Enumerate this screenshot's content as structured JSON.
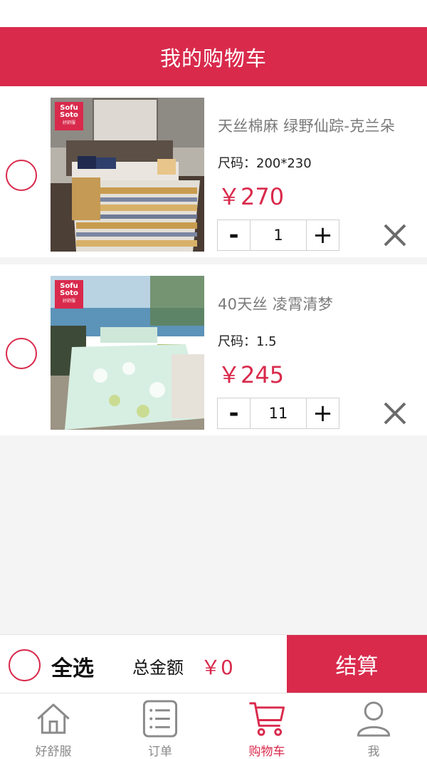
{
  "header": {
    "title": "我的购物车"
  },
  "cart": {
    "items": [
      {
        "title": "天丝棉麻 绿野仙踪-克兰朵",
        "size": "尺码：200*230",
        "price": "￥270",
        "quantity": "1",
        "brand": {
          "line1": "Sofu",
          "line2": "Soto",
          "line3": "好舒服"
        },
        "minus_label": "-",
        "plus_label": "+"
      },
      {
        "title": "40天丝 凌霄清梦",
        "size": "尺码：1.5",
        "price": "￥245",
        "quantity": "11",
        "brand": {
          "line1": "Sofu",
          "line2": "Soto",
          "line3": "好舒服"
        },
        "minus_label": "-",
        "plus_label": "+"
      }
    ]
  },
  "footer": {
    "select_all_label": "全选",
    "total_label": "总金额",
    "total_value": "￥0",
    "checkout_label": "结算"
  },
  "tabbar": {
    "tabs": [
      {
        "label": "好舒服",
        "icon": "home-icon",
        "active": false
      },
      {
        "label": "订单",
        "icon": "order-list-icon",
        "active": false
      },
      {
        "label": "购物车",
        "icon": "cart-icon",
        "active": true
      },
      {
        "label": "我",
        "icon": "person-icon",
        "active": false
      }
    ]
  },
  "colors": {
    "accent": "#d92a4c",
    "background": "#f4f4f4",
    "tab_inactive": "#8a8a8a"
  }
}
